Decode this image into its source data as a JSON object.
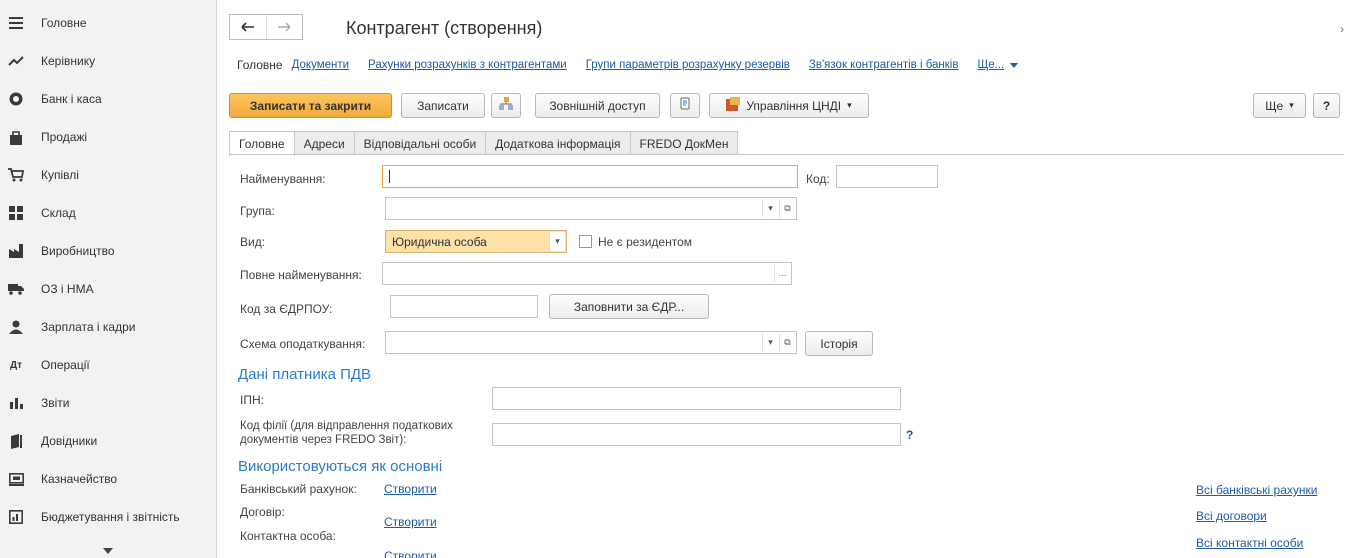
{
  "sidebar": {
    "items": [
      {
        "label": "Головне",
        "icon": "menu-icon"
      },
      {
        "label": "Керівнику",
        "icon": "trend-icon"
      },
      {
        "label": "Банк і каса",
        "icon": "bank-icon"
      },
      {
        "label": "Продажі",
        "icon": "sales-icon"
      },
      {
        "label": "Купівлі",
        "icon": "cart-icon"
      },
      {
        "label": "Склад",
        "icon": "warehouse-icon"
      },
      {
        "label": "Виробництво",
        "icon": "factory-icon"
      },
      {
        "label": "ОЗ і НМА",
        "icon": "truck-icon"
      },
      {
        "label": "Зарплата і кадри",
        "icon": "person-icon"
      },
      {
        "label": "Операції",
        "icon": "operations-icon"
      },
      {
        "label": "Звіти",
        "icon": "reports-icon"
      },
      {
        "label": "Довідники",
        "icon": "book-icon"
      },
      {
        "label": "Казначейство",
        "icon": "treasury-icon"
      },
      {
        "label": "Бюджетування і звітність",
        "icon": "budget-icon"
      }
    ]
  },
  "header": {
    "title": "Контрагент (створення)",
    "back_glyph": "🡐",
    "forward_glyph": "🡒",
    "close_glyph": "×"
  },
  "toplinks": {
    "current": "Головне",
    "links": [
      "Документи",
      "Рахунки розрахунків з контрагентами",
      "Групи параметрів розрахунку резервів",
      "Зв'язок контрагентів і банків"
    ],
    "more": "Ще..."
  },
  "toolbar": {
    "save_close": "Записати та закрити",
    "save": "Записати",
    "external_access": "Зовнішній доступ",
    "manage_cndi": "Управління ЦНДІ",
    "more": "Ще",
    "help": "?"
  },
  "tabs": [
    "Головне",
    "Адреси",
    "Відповідальні особи",
    "Додаткова інформація",
    "FREDO ДокМен"
  ],
  "form": {
    "name_label": "Найменування:",
    "name_value": "",
    "code_label": "Код:",
    "code_value": "",
    "group_label": "Група:",
    "group_value": "",
    "kind_label": "Вид:",
    "kind_value": "Юридична особа",
    "nonresident_label": "Не є резидентом",
    "fullname_label": "Повне найменування:",
    "fullname_value": "",
    "edrpou_label": "Код за ЄДРПОУ:",
    "edrpou_value": "",
    "fill_edr_button": "Заповнити за ЄДР...",
    "tax_scheme_label": "Схема оподаткування:",
    "tax_scheme_value": "",
    "history_button": "Історія"
  },
  "vat": {
    "section_title": "Дані платника ПДВ",
    "ipn_label": "ІПН:",
    "ipn_value": "",
    "branch_label_1": "Код філії (для відправлення податкових",
    "branch_label_2": "документів через FREDO Звіт):",
    "branch_value": "",
    "help": "?"
  },
  "defaults": {
    "section_title": "Використовуються як основні",
    "bank_label": "Банківський рахунок:",
    "bank_link": "Створити",
    "contract_label": "Договір:",
    "contract_link": "Створити",
    "contact_label": "Контактна особа:",
    "contact_link": "Створити",
    "all_bank_accounts": "Всі банківські рахунки",
    "all_contracts": "Всі договори",
    "all_contacts": "Всі контактні особи"
  },
  "colors": {
    "accent": "#f2a93b",
    "link": "#1c5ca8",
    "section": "#2c7bc9"
  }
}
